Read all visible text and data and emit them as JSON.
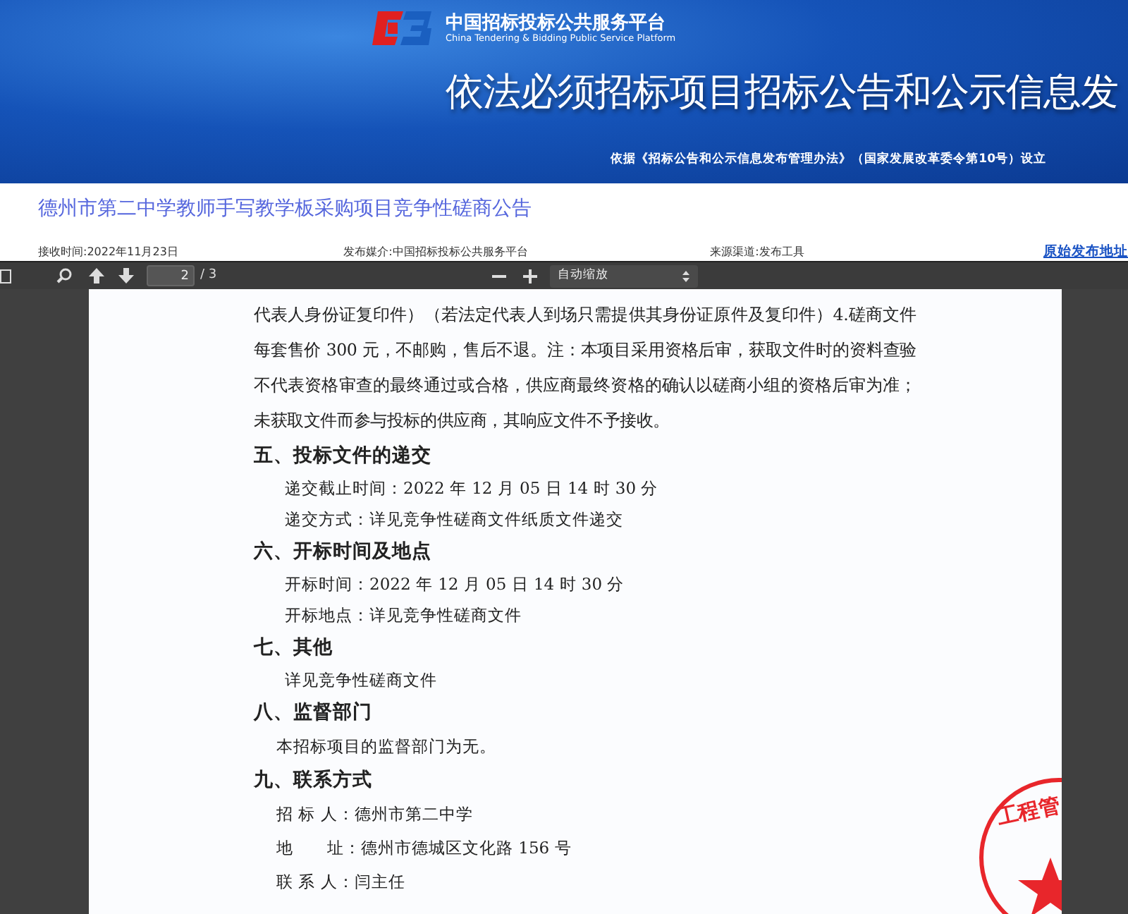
{
  "banner": {
    "logo_cn": "中国招标投标公共服务平台",
    "logo_en": "China Tendering & Bidding Public Service Platform",
    "headline": "依法必须招标项目招标公告和公示信息发",
    "basis": "依据《招标公告和公示信息发布管理办法》（国家发展改革委令第10号）设立"
  },
  "notice": {
    "title": "德州市第二中学教师手写教学板采购项目竞争性磋商公告",
    "received": "接收时间:2022年11月23日",
    "media": "发布媒介:中国招标投标公共服务平台",
    "source": "来源渠道:发布工具",
    "original_link": "原始发布地址"
  },
  "viewer_toolbar": {
    "page_value": "2",
    "page_total": "/ 3",
    "zoom": "自动缩放"
  },
  "document": {
    "blocks": [
      {
        "kind": "para",
        "text": "代表人身份证复印件）（若法定代表人到场只需提供其身份证原件及复印件）4.磋商文件每套售价 300 元，不邮购，售后不退。注：本项目采用资格后审，获取文件时的资料查验不代表资格审查的最终通过或合格，供应商最终资格的确认以磋商小组的资格后审为准；未获取文件而参与投标的供应商，其响应文件不予接收。"
      },
      {
        "kind": "heading",
        "text": "五、投标文件的递交"
      },
      {
        "kind": "line",
        "text": "递交截止时间：2022 年 12 月 05 日  14 时 30 分"
      },
      {
        "kind": "line",
        "text": "递交方式：详见竞争性磋商文件纸质文件递交"
      },
      {
        "kind": "heading",
        "text": "六、开标时间及地点"
      },
      {
        "kind": "line",
        "text": "开标时间：2022 年 12 月 05 日  14 时 30 分"
      },
      {
        "kind": "line",
        "text": "开标地点：详见竞争性磋商文件"
      },
      {
        "kind": "heading",
        "text": "七、其他"
      },
      {
        "kind": "line",
        "text": "详见竞争性磋商文件"
      },
      {
        "kind": "heading",
        "text": "八、监督部门"
      },
      {
        "kind": "body",
        "text": "本招标项目的监督部门为无。"
      },
      {
        "kind": "heading",
        "text": "九、联系方式"
      },
      {
        "kind": "body",
        "text": "招 标 人：德州市第二中学"
      },
      {
        "kind": "body",
        "text": "地　　址：德州市德城区文化路 156 号"
      },
      {
        "kind": "body",
        "text": "联 系 人：闫主任"
      }
    ],
    "seal": {
      "text": "工程管"
    }
  }
}
